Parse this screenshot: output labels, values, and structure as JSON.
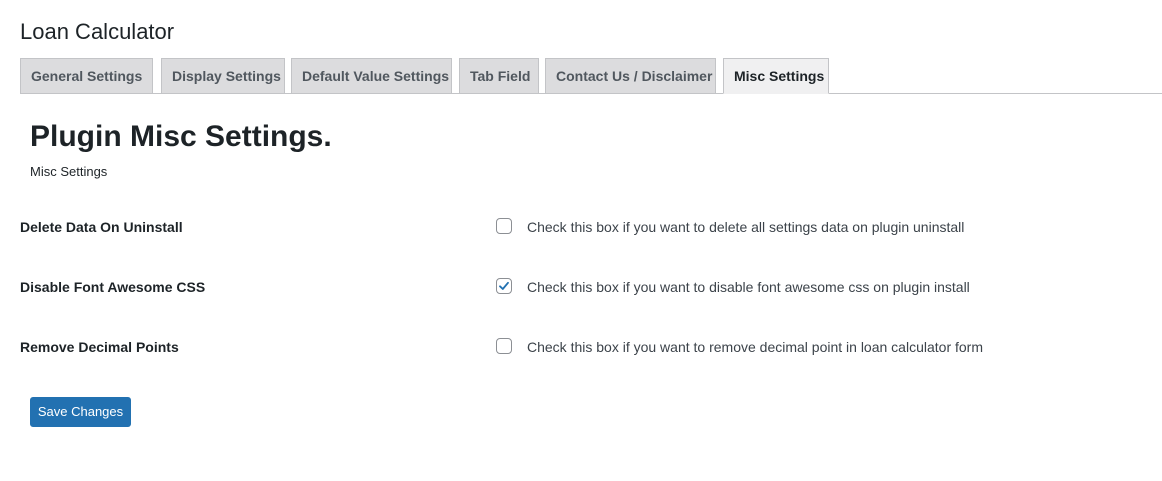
{
  "app": {
    "title": "Loan Calculator"
  },
  "tabs": [
    {
      "label": "General Settings",
      "active": false
    },
    {
      "label": "Display Settings",
      "active": false
    },
    {
      "label": "Default Value Settings",
      "active": false
    },
    {
      "label": "Tab Field",
      "active": false
    },
    {
      "label": "Contact Us / Disclaimer",
      "active": false
    },
    {
      "label": "Misc Settings",
      "active": true
    }
  ],
  "page": {
    "heading": "Plugin Misc Settings.",
    "subheading": "Misc Settings"
  },
  "settings": [
    {
      "label": "Delete Data On Uninstall",
      "checked": false,
      "description": "Check this box if you want to delete all settings data on plugin uninstall"
    },
    {
      "label": "Disable Font Awesome CSS",
      "checked": true,
      "description": "Check this box if you want to disable font awesome css on plugin install"
    },
    {
      "label": "Remove Decimal Points",
      "checked": false,
      "description": "Check this box if you want to remove decimal point in loan calculator form"
    }
  ],
  "actions": {
    "save_label": "Save Changes"
  },
  "colors": {
    "primary_button": "#2271b1",
    "checkmark": "#2271b1",
    "tab_inactive_bg": "#dcdcde",
    "tab_active_bg": "#f0f0f1",
    "text": "#1d2327"
  }
}
